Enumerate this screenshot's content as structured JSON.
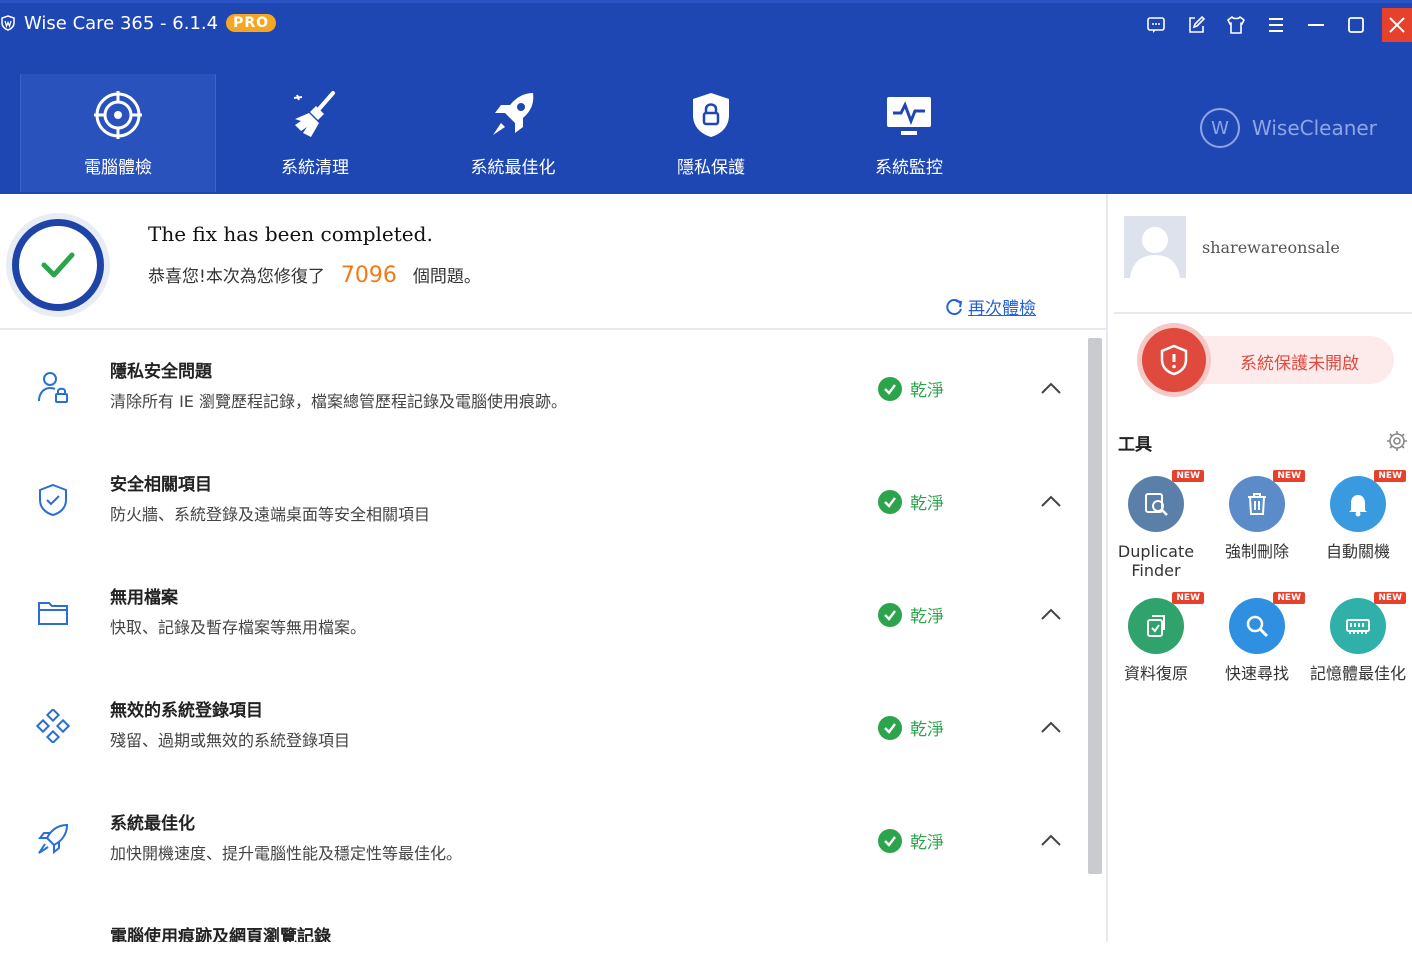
{
  "app": {
    "title": "Wise Care 365 - 6.1.4",
    "badge": "PRO",
    "brand": "WiseCleaner",
    "brand_letter": "W"
  },
  "window_buttons": [
    "feedback-icon",
    "edit-icon",
    "skin-icon",
    "menu-icon",
    "minimize-icon",
    "maximize-icon",
    "close-icon"
  ],
  "nav": [
    {
      "label": "電腦體檢",
      "icon": "radar-icon",
      "active": true
    },
    {
      "label": "系統清理",
      "icon": "broom-icon",
      "active": false
    },
    {
      "label": "系統最佳化",
      "icon": "rocket-icon",
      "active": false
    },
    {
      "label": "隱私保護",
      "icon": "privacy-shield-icon",
      "active": false
    },
    {
      "label": "系統監控",
      "icon": "monitor-icon",
      "active": false
    }
  ],
  "summary": {
    "title": "The fix has been completed.",
    "prefix": "恭喜您!本次為您修復了",
    "count": "7096",
    "suffix": "個問題。",
    "recheck": "再次體檢"
  },
  "items": [
    {
      "title": "隱私安全問題",
      "desc": "清除所有 IE 瀏覽歷程記錄，檔案總管歷程記錄及電腦使用痕跡。",
      "status": "乾淨",
      "icon": "user-lock-icon"
    },
    {
      "title": "安全相關項目",
      "desc": "防火牆、系統登錄及遠端桌面等安全相關項目",
      "status": "乾淨",
      "icon": "shield-check-icon"
    },
    {
      "title": "無用檔案",
      "desc": "快取、記錄及暫存檔案等無用檔案。",
      "status": "乾淨",
      "icon": "folder-icon"
    },
    {
      "title": "無效的系統登錄項目",
      "desc": "殘留、過期或無效的系統登錄項目",
      "status": "乾淨",
      "icon": "registry-icon"
    },
    {
      "title": "系統最佳化",
      "desc": "加快開機速度、提升電腦性能及穩定性等最佳化。",
      "status": "乾淨",
      "icon": "rocket-outline-icon"
    },
    {
      "title": "電腦使用痕跡及網頁瀏覽記錄",
      "desc": "",
      "status": "",
      "icon": ""
    }
  ],
  "user": {
    "name": "sharewareonsale"
  },
  "protection": {
    "label": "系統保護未開啟"
  },
  "tools": {
    "title": "工具",
    "new_badge": "NEW",
    "items": [
      {
        "label": "Duplicate Finder",
        "icon": "duplicate-finder-icon",
        "color": "#5a7fa8"
      },
      {
        "label": "強制刪除",
        "icon": "trash-icon",
        "color": "#5c8bc9"
      },
      {
        "label": "自動關機",
        "icon": "bell-icon",
        "color": "#3a9ae0"
      },
      {
        "label": "資料復原",
        "icon": "data-recovery-icon",
        "color": "#2fa36b"
      },
      {
        "label": "快速尋找",
        "icon": "magnifier-icon",
        "color": "#2f8fe0"
      },
      {
        "label": "記憶體最佳化",
        "icon": "memory-icon",
        "color": "#2fb0a8"
      }
    ]
  },
  "colors": {
    "header": "#1f47b3",
    "accent_orange": "#f07a1a",
    "status_green": "#2ca44b",
    "alert_red": "#e0493d",
    "link_blue": "#2463d6"
  }
}
